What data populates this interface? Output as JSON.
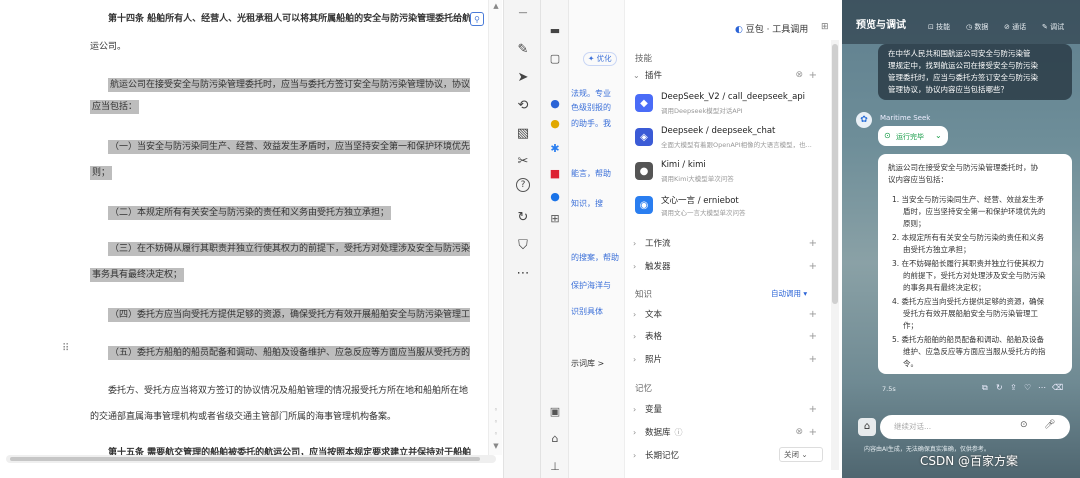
{
  "document": {
    "lines": [
      {
        "text": "第十四条  船舶所有人、经营人、光租承租人可以将其所属船舶的安全与防污染管理委托给航",
        "bold": true,
        "hl": false
      },
      {
        "text": "运公司。",
        "bold": false,
        "hl": false
      },
      {
        "text": "航运公司在接受安全与防污染管理委托时，应当与委托方签订安全与防污染管理协议，协议内容",
        "bold": false,
        "hl": true
      },
      {
        "text": "应当包括：",
        "bold": false,
        "hl": true
      },
      {
        "text": "（一）当安全与防污染同生产、经营、效益发生矛盾时，应当坚持安全第一和保护环境优先的原",
        "bold": false,
        "hl": true
      },
      {
        "text": "则；",
        "bold": false,
        "hl": true
      },
      {
        "text": "（二）本规定所有有关安全与防污染的责任和义务由受托方独立承担；",
        "bold": false,
        "hl": true
      },
      {
        "text": "（三）在不妨碍从履行其职责并独立行使其权力的前提下，受托方对处理涉及安全与防污染的",
        "bold": false,
        "hl": true
      },
      {
        "text": "事务具有最终决定权；",
        "bold": false,
        "hl": true
      },
      {
        "text": "（四）委托方应当向受托方提供足够的资源，确保受托方有效开展船舶安全与防污染管理工作；",
        "bold": false,
        "hl": true
      },
      {
        "text": "（五）委托方船舶的船员配备和调动、船舶及设备维护、应急反应等方面应当服从受托方的指令。",
        "bold": false,
        "hl": true
      },
      {
        "text": "委托方、受托方应当将双方签订的协议情况及船舶管理的情况报受托方所在地和船舶所在地",
        "bold": false,
        "hl": false
      },
      {
        "text": "的交通部直属海事管理机构或者省级交通主管部门所属的海事管理机构备案。",
        "bold": false,
        "hl": false
      },
      {
        "text": "第十五条  需要航交管理的船舶被委托的航运公司，应当按照本规定要求建立并保持对于船舶",
        "bold": true,
        "hl": false
      }
    ]
  },
  "toolbar": {
    "icons": [
      "pen-icon",
      "cursor-icon",
      "lasso-icon",
      "image-icon",
      "scissors-icon",
      "help-icon",
      "rotate-icon",
      "shield-icon",
      "more-icon"
    ]
  },
  "partial": {
    "tag": "✦ 优化",
    "texts": [
      "法规。专业",
      "色级别报的",
      "的助手。我",
      "能言，帮助",
      "知识，搜",
      "的搜案，帮助",
      "保护海洋与",
      "识别具体",
      "示词库  >"
    ]
  },
  "plugin_panel": {
    "header_right": "豆包 · 工具调用",
    "skills_title": "技能",
    "plugins_title": "插件",
    "plugins": [
      {
        "name": "DeepSeek_V2 / call_deepseek_api",
        "desc": "调用Deepseek模型对话API",
        "color": "#4a6cf7"
      },
      {
        "name": "Deepseek / deepseek_chat",
        "desc": "全面大模型有着跟OpenAPI相像的大语言模型，也...",
        "color": "#3b5bd6"
      },
      {
        "name": "Kimi / kimi",
        "desc": "调用Kimi大模型单次问答",
        "color": "#555"
      },
      {
        "name": "文心一言 / erniebot",
        "desc": "调用文心一言大模型单次问答",
        "color": "#2a7ef0"
      }
    ],
    "workflow": "工作流",
    "trigger": "触发器",
    "knowledge_title": "知识",
    "auto_call": "自动调用",
    "text": "文本",
    "table": "表格",
    "photo": "照片",
    "memory_title": "记忆",
    "variable": "变量",
    "database": "数据库",
    "long_memory": "长期记忆",
    "long_memory_value": "关闭"
  },
  "chat": {
    "title": "预览与调试",
    "actions": [
      "⊡ 技能",
      "◷ 数据",
      "⊘ 通话",
      "✎ 调试"
    ],
    "user_msg": [
      "在中华人民共和国航运公司安全与防污染管",
      "理规定中，找到航运公司在接受安全与防污染",
      "管理委托时，应当与委托方签订安全与防污染",
      "管理协议，协议内容应当包括哪些？"
    ],
    "bot_name": "Maritime Seek",
    "status": "运行完毕",
    "answer_intro": [
      "航运公司在接受安全与防污染管理委托时，协",
      "议内容应当包括："
    ],
    "answer_items": [
      [
        "1. 当安全与防污染同生产、经营、效益发生矛",
        "盾时，应当坚持安全第一和保护环境优先的",
        "原则；"
      ],
      [
        "2. 本规定所有有关安全与防污染的责任和义务",
        "由受托方独立承担；"
      ],
      [
        "3. 在不妨碍船长履行其职责并独立行使其权力",
        "的前提下，受托方对处理涉及安全与防污染",
        "的事务具有最终决定权；"
      ],
      [
        "4. 委托方应当向受托方提供足够的资源，确保",
        "受托方有效开展船舶安全与防污染管理工",
        "作；"
      ],
      [
        "5. 委托方船舶的船员配备和调动、船舶及设备",
        "维护、应急反应等方面应当服从受托方的指",
        "令。"
      ]
    ],
    "time": "7.5s",
    "input_placeholder": "继续对话...",
    "footer": "内容由AI生成，无法确保真实准确，仅供参考。",
    "watermark": "CSDN @百家方案"
  }
}
